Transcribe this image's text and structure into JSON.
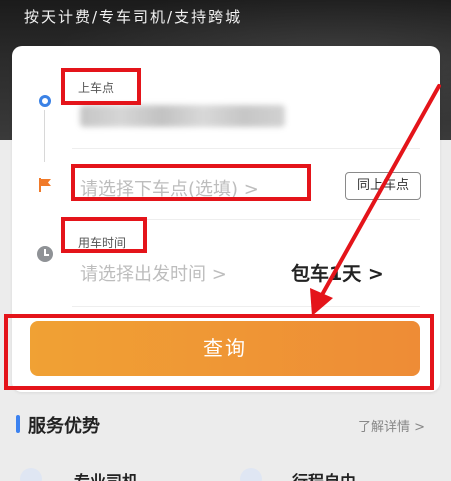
{
  "header": {
    "slogan": "按天计费/专车司机/支持跨城"
  },
  "form": {
    "pickup_label": "上车点",
    "dropoff_placeholder": "请选择下车点(选填) >",
    "same_as_pickup_label": "同上车点",
    "time_label": "用车时间",
    "time_placeholder": "请选择出发时间 >",
    "charter_label": "包车1天 >",
    "query_button_label": "查询"
  },
  "services": {
    "title": "服务优势",
    "more_link": "了解详情 >",
    "items": [
      {
        "label": "专业司机"
      },
      {
        "label": "行程自由"
      }
    ]
  },
  "colors": {
    "accent_blue": "#3b82e6",
    "button_orange": "#f0a134",
    "annotation_red": "#e4141a"
  },
  "icons": [
    "pickup-dot-icon",
    "flag-icon",
    "clock-icon",
    "chevron-right-icon"
  ]
}
